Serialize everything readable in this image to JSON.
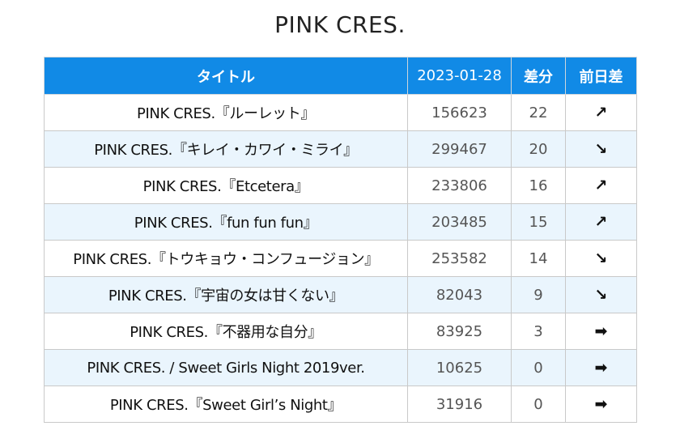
{
  "page": {
    "title": "PINK CRES."
  },
  "table": {
    "headers": {
      "title": "タイトル",
      "date": "2023-01-28",
      "diff": "差分",
      "trend": "前日差"
    },
    "rows": [
      {
        "title": "PINK CRES.『ルーレット』",
        "count": "156623",
        "diff": "22",
        "trend": "↗",
        "trend_name": "trend-up-icon"
      },
      {
        "title": "PINK CRES.『キレイ・カワイ・ミライ』",
        "count": "299467",
        "diff": "20",
        "trend": "↘",
        "trend_name": "trend-down-icon"
      },
      {
        "title": "PINK CRES.『Etcetera』",
        "count": "233806",
        "diff": "16",
        "trend": "↗",
        "trend_name": "trend-up-icon"
      },
      {
        "title": "PINK CRES.『fun fun fun』",
        "count": "203485",
        "diff": "15",
        "trend": "↗",
        "trend_name": "trend-up-icon"
      },
      {
        "title": "PINK CRES.『トウキョウ・コンフュージョン』",
        "count": "253582",
        "diff": "14",
        "trend": "↘",
        "trend_name": "trend-down-icon"
      },
      {
        "title": "PINK CRES.『宇宙の女は甘くない』",
        "count": "82043",
        "diff": "9",
        "trend": "↘",
        "trend_name": "trend-down-icon"
      },
      {
        "title": "PINK CRES.『不器用な自分』",
        "count": "83925",
        "diff": "3",
        "trend": "➡",
        "trend_name": "trend-flat-icon"
      },
      {
        "title": "PINK CRES. / Sweet Girls Night 2019ver.",
        "count": "10625",
        "diff": "0",
        "trend": "➡",
        "trend_name": "trend-flat-icon"
      },
      {
        "title": "PINK CRES.『Sweet Girl’s Night』",
        "count": "31916",
        "diff": "0",
        "trend": "➡",
        "trend_name": "trend-flat-icon"
      }
    ]
  },
  "colors": {
    "header_bg": "#118ae6",
    "stripe_bg": "#eaf5fd"
  }
}
